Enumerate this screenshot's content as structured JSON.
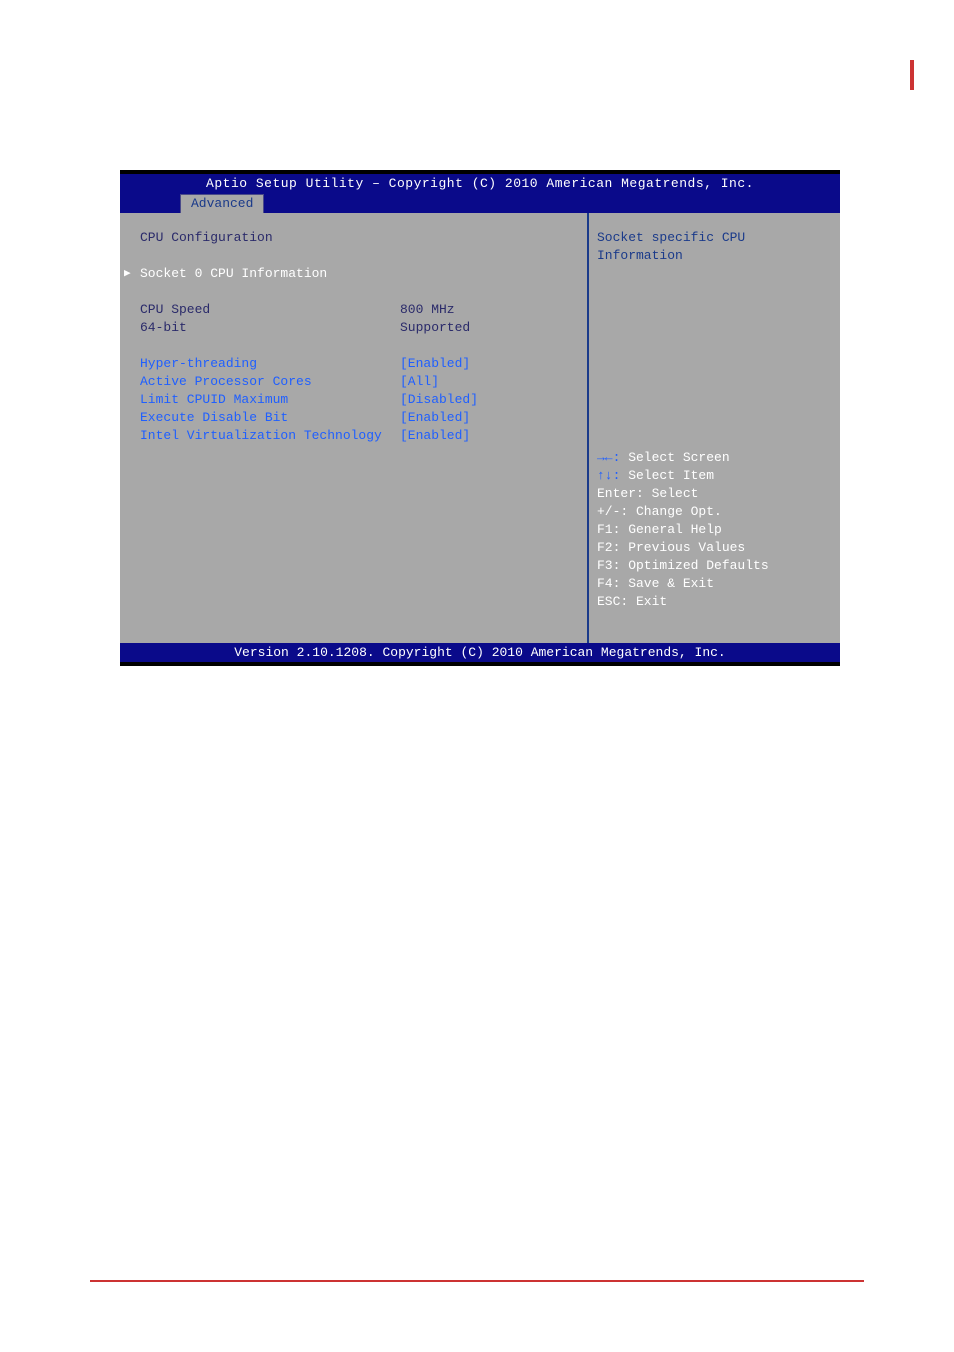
{
  "header": {
    "title": "Aptio Setup Utility – Copyright (C) 2010 American Megatrends, Inc.",
    "active_tab": "Advanced"
  },
  "main": {
    "section_title": "CPU Configuration",
    "submenu": "Socket 0 CPU Information",
    "info": [
      {
        "label": "CPU Speed",
        "value": "800 MHz"
      },
      {
        "label": "64-bit",
        "value": "Supported"
      }
    ],
    "options": [
      {
        "label": "Hyper-threading",
        "value": "[Enabled]"
      },
      {
        "label": "Active Processor Cores",
        "value": "[All]"
      },
      {
        "label": "Limit CPUID Maximum",
        "value": "[Disabled]"
      },
      {
        "label": "Execute Disable Bit",
        "value": "[Enabled]"
      },
      {
        "label": "Intel Virtualization Technology",
        "value": "[Enabled]"
      }
    ]
  },
  "side": {
    "help_text": "Socket specific CPU Information",
    "keys": {
      "select_screen_key": "→←:",
      "select_screen": " Select Screen",
      "select_item_key": "↑↓:",
      "select_item": " Select Item",
      "enter": "Enter: Select",
      "change": "+/-: Change Opt.",
      "f1": "F1: General Help",
      "f2": "F2: Previous Values",
      "f3": "F3: Optimized Defaults",
      "f4": "F4: Save & Exit",
      "esc": "ESC: Exit"
    }
  },
  "footer": {
    "text": "Version 2.10.1208. Copyright (C) 2010 American Megatrends, Inc."
  }
}
